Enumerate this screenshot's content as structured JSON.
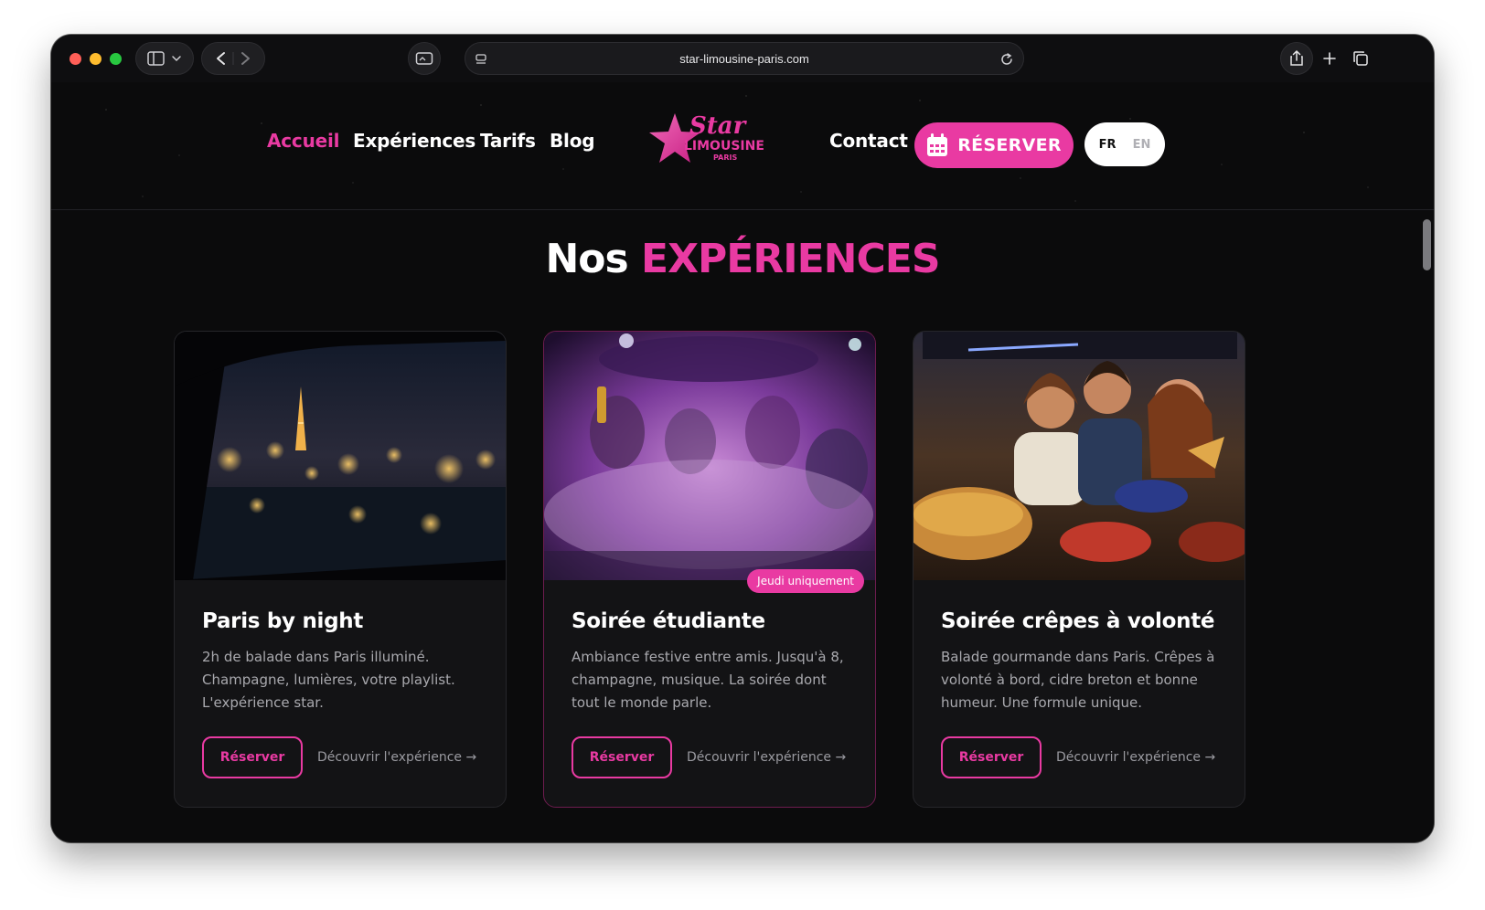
{
  "browser": {
    "url": "star-limousine-paris.com"
  },
  "nav": {
    "links": [
      "Accueil",
      "Expériences",
      "Tarifs",
      "Blog"
    ],
    "contact": "Contact",
    "reserve_button": "RÉSERVER",
    "lang": {
      "fr": "FR",
      "en": "EN"
    }
  },
  "logo": {
    "line1": "Star",
    "line2": "LIMOUSINE",
    "line3": "PARIS"
  },
  "section": {
    "title_prefix": "Nos",
    "title_accent": "EXPÉRIENCES"
  },
  "cards": [
    {
      "title": "Paris by night",
      "description": "2h de balade dans Paris illuminé. Champagne, lumières, votre playlist. L'expérience star.",
      "button": "Réserver",
      "link": "Découvrir l'expérience →"
    },
    {
      "title": "Soirée étudiante",
      "description": "Ambiance festive entre amis. Jusqu'à 8, champagne, musique. La soirée dont tout le monde parle.",
      "badge": "Jeudi uniquement",
      "button": "Réserver",
      "link": "Découvrir l'expérience →"
    },
    {
      "title": "Soirée crêpes à volonté",
      "description": "Balade gourmande dans Paris. Crêpes à volonté à bord, cidre breton et bonne humeur. Une formule unique.",
      "button": "Réserver",
      "link": "Découvrir l'expérience →"
    }
  ],
  "colors": {
    "accent": "#e93aa2",
    "background": "#0b0b0c"
  }
}
